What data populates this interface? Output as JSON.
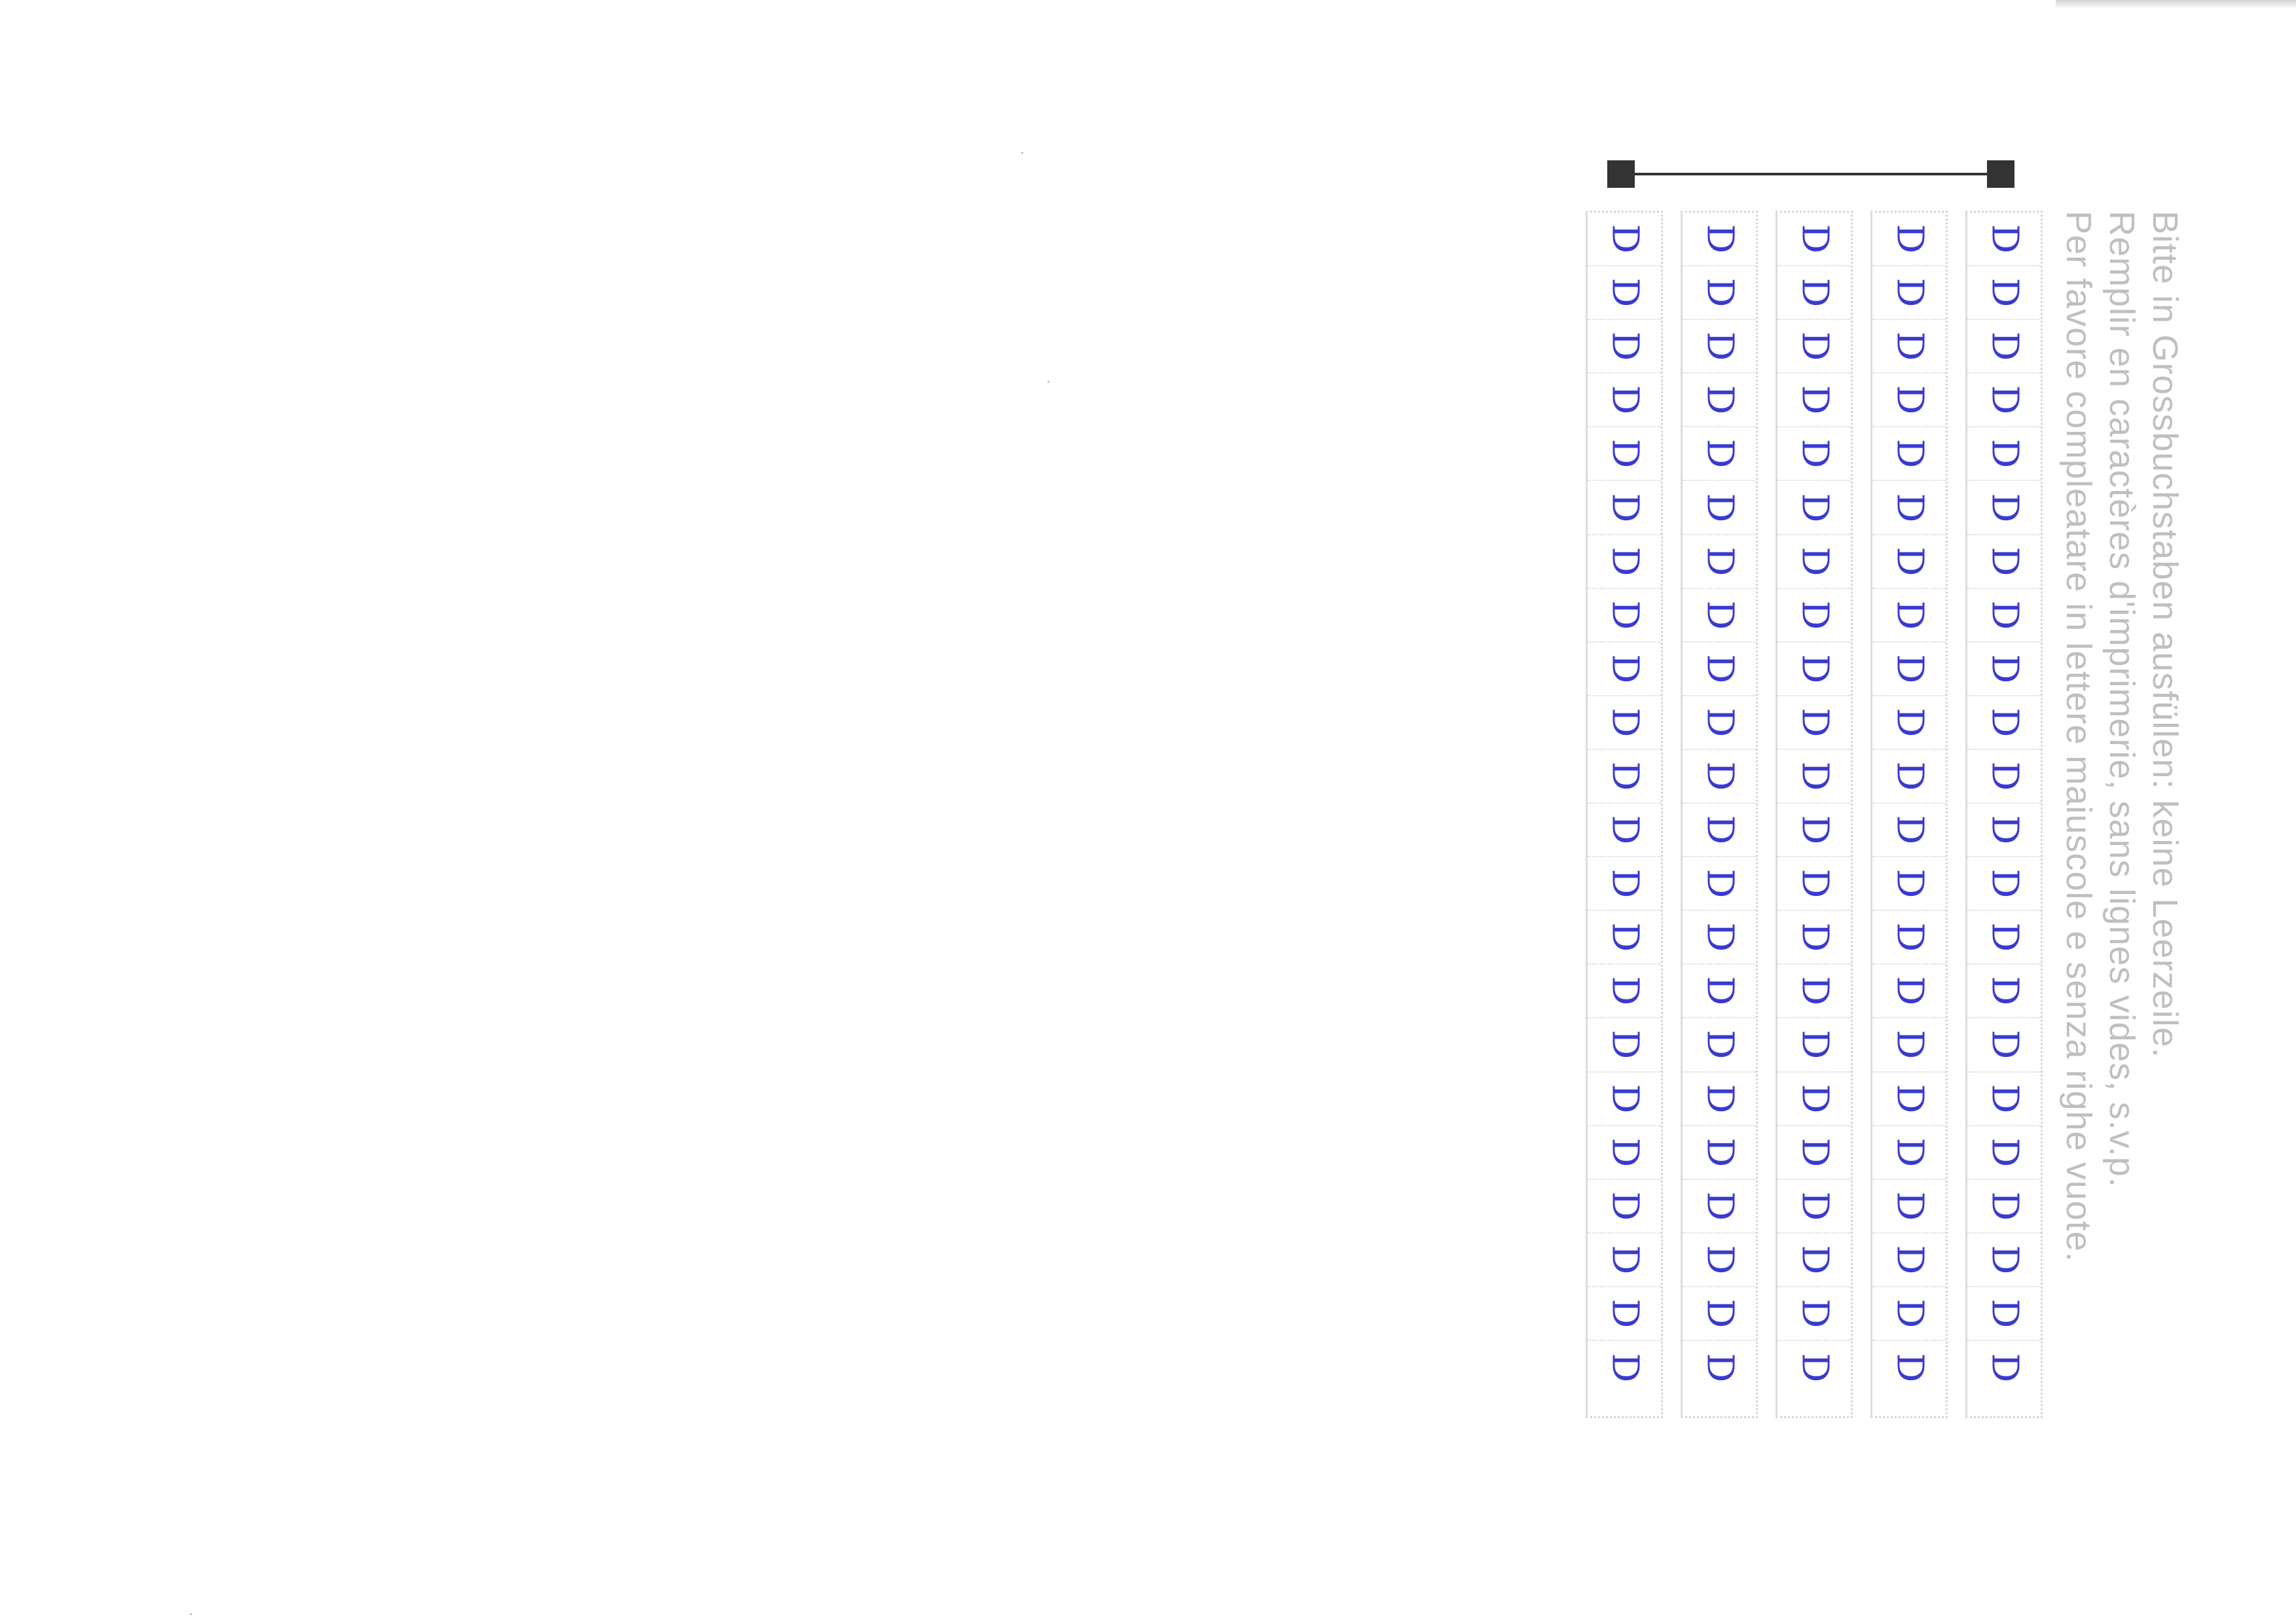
{
  "instructions": {
    "line_de": "Bitte in Grossbuchstaben ausfüllen: keine Leerzeile.",
    "line_fr": "Remplir en caractères d'imprimerie, sans lignes vides, s.v.p.",
    "line_it": "Per favore compleatare in lettere maiuscole e senza righe vuote."
  },
  "form": {
    "columns": [
      {
        "cells": [
          "D",
          "D",
          "D",
          "D",
          "D",
          "D",
          "D",
          "D",
          "D",
          "D",
          "D",
          "D",
          "D",
          "D",
          "D",
          "D",
          "D",
          "D",
          "D",
          "D",
          "D",
          "D"
        ]
      },
      {
        "cells": [
          "D",
          "D",
          "D",
          "D",
          "D",
          "D",
          "D",
          "D",
          "D",
          "D",
          "D",
          "D",
          "D",
          "D",
          "D",
          "D",
          "D",
          "D",
          "D",
          "D",
          "D",
          "D"
        ]
      },
      {
        "cells": [
          "D",
          "D",
          "D",
          "D",
          "D",
          "D",
          "D",
          "D",
          "D",
          "D",
          "D",
          "D",
          "D",
          "D",
          "D",
          "D",
          "D",
          "D",
          "D",
          "D",
          "D",
          "D"
        ]
      },
      {
        "cells": [
          "D",
          "D",
          "D",
          "D",
          "D",
          "D",
          "D",
          "D",
          "D",
          "D",
          "D",
          "D",
          "D",
          "D",
          "D",
          "D",
          "D",
          "D",
          "D",
          "D",
          "D",
          "D"
        ]
      },
      {
        "cells": [
          "D",
          "D",
          "D",
          "D",
          "D",
          "D",
          "D",
          "D",
          "D",
          "D",
          "D",
          "D",
          "D",
          "D",
          "D",
          "D",
          "D",
          "D",
          "D",
          "D",
          "D",
          "D"
        ]
      }
    ]
  },
  "colors": {
    "ink": "#3a3ad0",
    "print": "#bfbfbf",
    "marker": "#333333"
  }
}
